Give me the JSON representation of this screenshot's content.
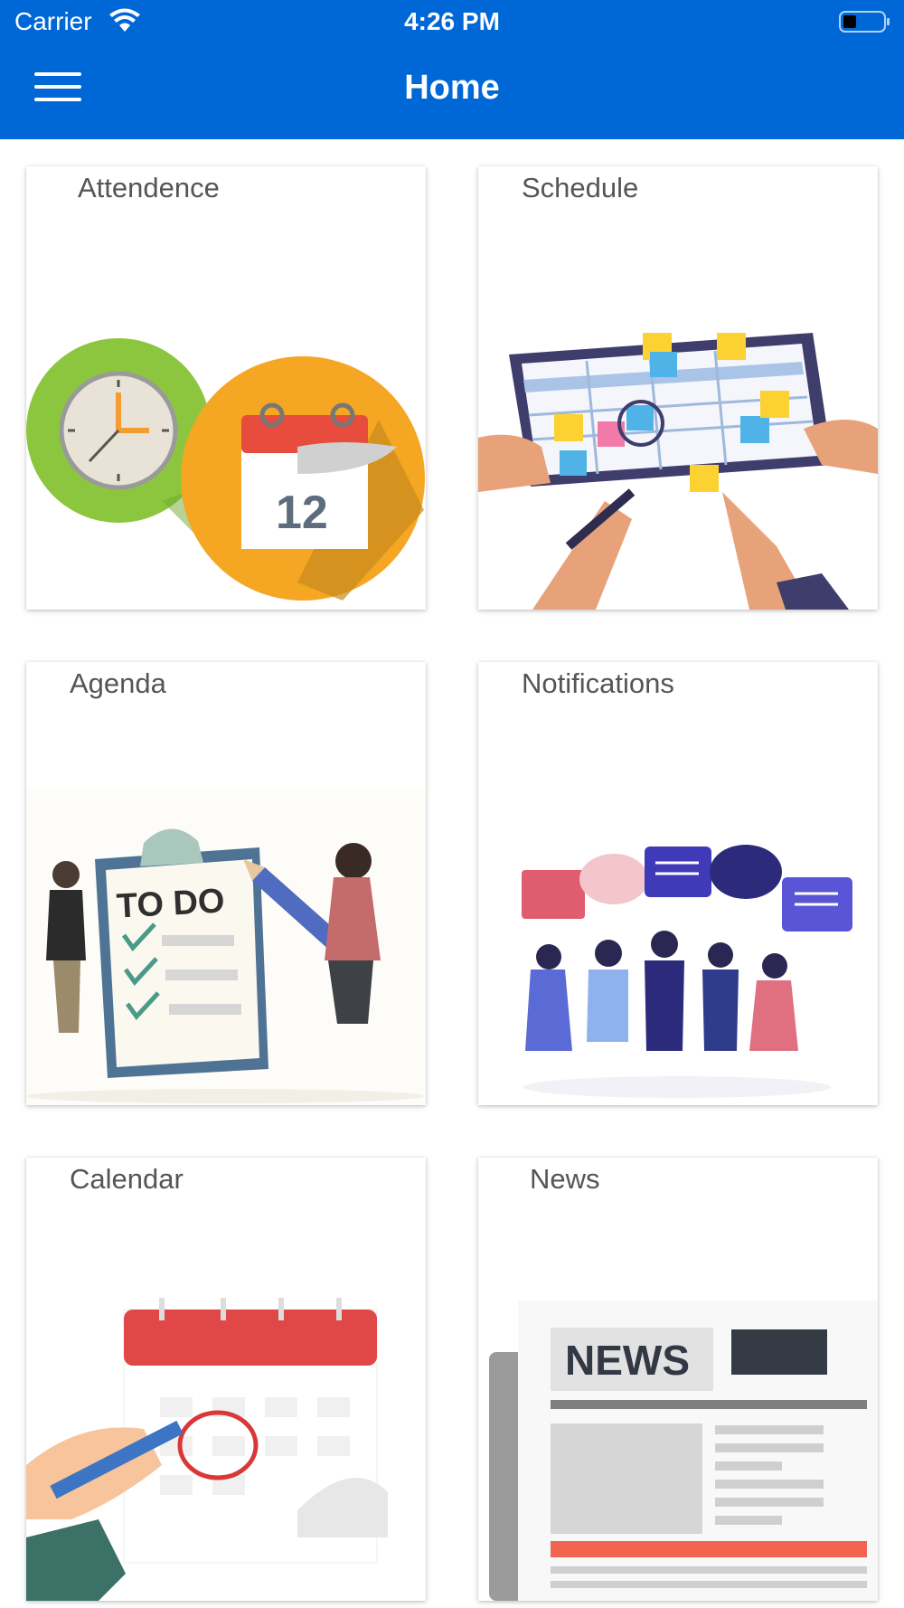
{
  "status_bar": {
    "carrier": "Carrier",
    "time": "4:26 PM"
  },
  "nav": {
    "title": "Home",
    "menu_icon": "hamburger-menu-icon"
  },
  "tiles": [
    {
      "label": "Attendence",
      "icon": "clock-calendar-illustration"
    },
    {
      "label": "Schedule",
      "icon": "schedule-board-illustration"
    },
    {
      "label": "Agenda",
      "icon": "todo-clipboard-illustration"
    },
    {
      "label": "Notifications",
      "icon": "people-speech-bubbles-illustration"
    },
    {
      "label": "Calendar",
      "icon": "calendar-illustration"
    },
    {
      "label": "News",
      "icon": "newspaper-illustration"
    }
  ],
  "art_text": {
    "calendar_day": "12",
    "todo": "TO DO",
    "news": "NEWS"
  },
  "colors": {
    "header": "#0068d6",
    "label": "#555555"
  }
}
